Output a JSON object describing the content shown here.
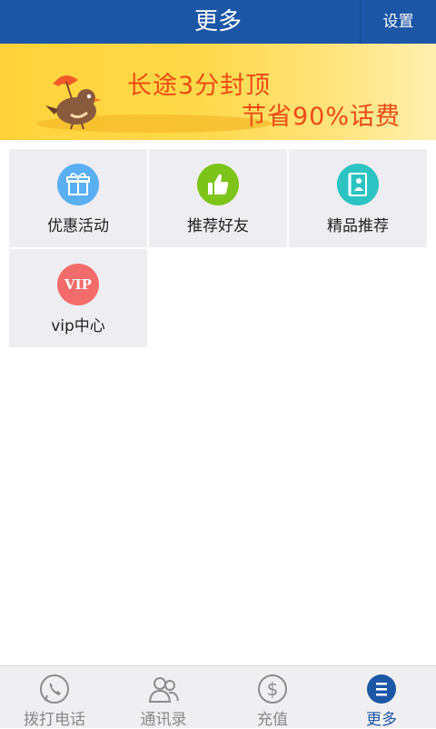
{
  "header": {
    "title": "更多",
    "settings_label": "设置"
  },
  "banner": {
    "line1": "长途3分封顶",
    "line2": "节省90%话费"
  },
  "grid": {
    "items": [
      {
        "label": "优惠活动",
        "icon": "gift-icon",
        "color": "#5aaef2"
      },
      {
        "label": "推荐好友",
        "icon": "thumbs-up-icon",
        "color": "#7cc41a"
      },
      {
        "label": "精品推荐",
        "icon": "app-book-icon",
        "color": "#2cc3c2"
      },
      {
        "label": "vip中心",
        "icon": "vip-icon",
        "icon_text": "VIP",
        "color": "#f36b6b"
      }
    ]
  },
  "tabs": [
    {
      "label": "拨打电话",
      "icon": "phone-icon",
      "active": false
    },
    {
      "label": "通讯录",
      "icon": "contacts-icon",
      "active": false
    },
    {
      "label": "充值",
      "icon": "dollar-icon",
      "active": false
    },
    {
      "label": "更多",
      "icon": "menu-icon",
      "active": true
    }
  ],
  "colors": {
    "header": "#1c56a6",
    "banner_text": "#f04a16",
    "tile_bg": "#eeedf1",
    "active_tab": "#1c56a6"
  }
}
